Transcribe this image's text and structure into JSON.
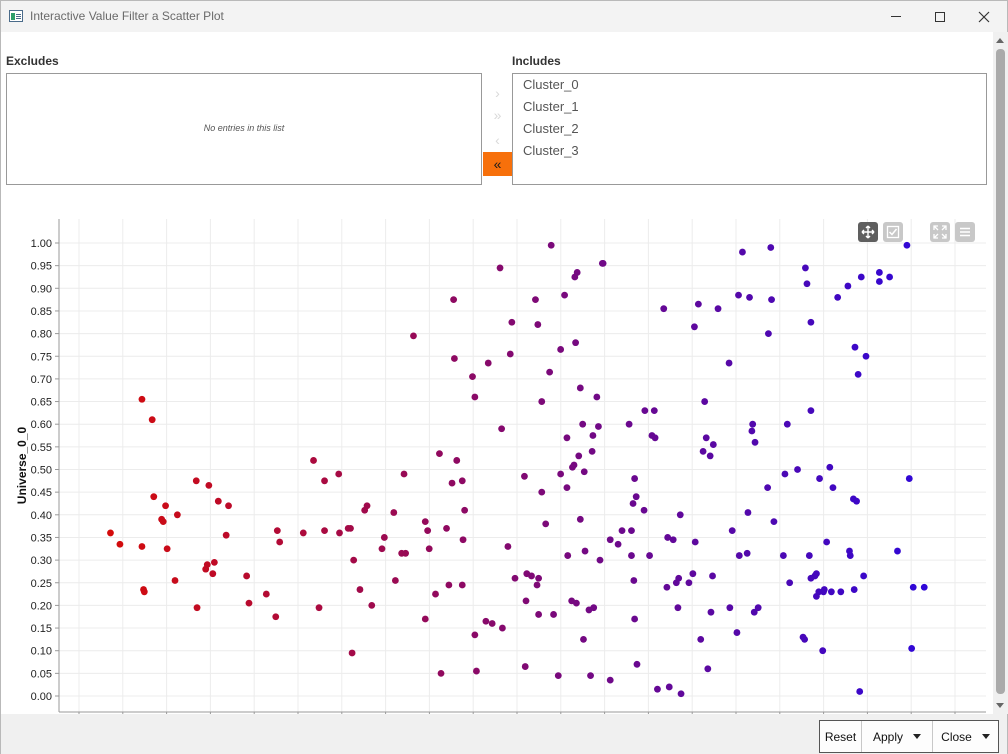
{
  "window": {
    "title": "Interactive Value Filter a Scatter Plot",
    "app_icon": "table-chart-icon",
    "controls": [
      "minimize-icon",
      "maximize-icon",
      "close-icon"
    ]
  },
  "filter": {
    "excludes_label": "Excludes",
    "includes_label": "Includes",
    "excludes_empty": "No entries in this list",
    "includes": [
      "Cluster_0",
      "Cluster_1",
      "Cluster_2",
      "Cluster_3"
    ],
    "arrows": [
      {
        "icon": "chevron-right-icon",
        "glyph": "›",
        "active": false
      },
      {
        "icon": "double-chevron-right-icon",
        "glyph": "»",
        "active": false
      },
      {
        "icon": "chevron-left-icon",
        "glyph": "‹",
        "active": false
      },
      {
        "icon": "double-chevron-left-icon",
        "glyph": "«",
        "active": true
      }
    ],
    "accent_color": "#f7700b"
  },
  "toolbar": {
    "icons": [
      "pan-icon",
      "selection-icon",
      "fullscreen-icon",
      "menu-icon"
    ]
  },
  "buttons": {
    "reset": "Reset",
    "apply": "Apply",
    "close": "Close"
  },
  "chart_data": {
    "type": "scatter",
    "ylabel": "Universe_0_0",
    "xlabel": "",
    "ylim": [
      0,
      1
    ],
    "xlim": [
      0,
      1
    ],
    "yticks": [
      "0.00",
      "0.05",
      "0.10",
      "0.15",
      "0.20",
      "0.25",
      "0.30",
      "0.35",
      "0.40",
      "0.45",
      "0.50",
      "0.55",
      "0.60",
      "0.65",
      "0.70",
      "0.75",
      "0.80",
      "0.85",
      "0.90",
      "0.95",
      "1.00"
    ],
    "grid": true,
    "color_gradient": [
      "#d40b0b",
      "#2f07d8"
    ],
    "points": [
      [
        0.04,
        0.36
      ],
      [
        0.052,
        0.335
      ],
      [
        0.08,
        0.655
      ],
      [
        0.08,
        0.33
      ],
      [
        0.082,
        0.235
      ],
      [
        0.083,
        0.23
      ],
      [
        0.093,
        0.61
      ],
      [
        0.095,
        0.44
      ],
      [
        0.105,
        0.39
      ],
      [
        0.107,
        0.385
      ],
      [
        0.11,
        0.42
      ],
      [
        0.112,
        0.325
      ],
      [
        0.122,
        0.255
      ],
      [
        0.125,
        0.4
      ],
      [
        0.149,
        0.475
      ],
      [
        0.15,
        0.195
      ],
      [
        0.161,
        0.28
      ],
      [
        0.163,
        0.29
      ],
      [
        0.165,
        0.465
      ],
      [
        0.172,
        0.295
      ],
      [
        0.17,
        0.27
      ],
      [
        0.177,
        0.43
      ],
      [
        0.187,
        0.355
      ],
      [
        0.19,
        0.42
      ],
      [
        0.213,
        0.265
      ],
      [
        0.216,
        0.205
      ],
      [
        0.238,
        0.225
      ],
      [
        0.25,
        0.175
      ],
      [
        0.252,
        0.365
      ],
      [
        0.255,
        0.34
      ],
      [
        0.285,
        0.36
      ],
      [
        0.298,
        0.52
      ],
      [
        0.305,
        0.195
      ],
      [
        0.312,
        0.475
      ],
      [
        0.312,
        0.365
      ],
      [
        0.33,
        0.49
      ],
      [
        0.331,
        0.36
      ],
      [
        0.342,
        0.37
      ],
      [
        0.345,
        0.37
      ],
      [
        0.347,
        0.095
      ],
      [
        0.349,
        0.3
      ],
      [
        0.357,
        0.235
      ],
      [
        0.363,
        0.41
      ],
      [
        0.366,
        0.42
      ],
      [
        0.372,
        0.2
      ],
      [
        0.388,
        0.35
      ],
      [
        0.385,
        0.325
      ],
      [
        0.4,
        0.405
      ],
      [
        0.402,
        0.255
      ],
      [
        0.41,
        0.315
      ],
      [
        0.415,
        0.315
      ],
      [
        0.413,
        0.49
      ],
      [
        0.425,
        0.795
      ],
      [
        0.44,
        0.385
      ],
      [
        0.44,
        0.17
      ],
      [
        0.445,
        0.325
      ],
      [
        0.443,
        0.365
      ],
      [
        0.453,
        0.225
      ],
      [
        0.46,
        0.05
      ],
      [
        0.458,
        0.535
      ],
      [
        0.467,
        0.37
      ],
      [
        0.47,
        0.245
      ],
      [
        0.476,
        0.875
      ],
      [
        0.474,
        0.47
      ],
      [
        0.48,
        0.52
      ],
      [
        0.477,
        0.745
      ],
      [
        0.487,
        0.475
      ],
      [
        0.487,
        0.245
      ],
      [
        0.49,
        0.41
      ],
      [
        0.488,
        0.345
      ],
      [
        0.5,
        0.705
      ],
      [
        0.503,
        0.66
      ],
      [
        0.505,
        0.055
      ],
      [
        0.503,
        0.135
      ],
      [
        0.517,
        0.165
      ],
      [
        0.52,
        0.735
      ],
      [
        0.525,
        0.16
      ],
      [
        0.535,
        0.945
      ],
      [
        0.537,
        0.59
      ],
      [
        0.538,
        0.15
      ],
      [
        0.545,
        0.33
      ],
      [
        0.548,
        0.755
      ],
      [
        0.55,
        0.825
      ],
      [
        0.554,
        0.26
      ],
      [
        0.566,
        0.485
      ],
      [
        0.567,
        0.065
      ],
      [
        0.568,
        0.21
      ],
      [
        0.569,
        0.27
      ],
      [
        0.575,
        0.265
      ],
      [
        0.58,
        0.875
      ],
      [
        0.584,
        0.26
      ],
      [
        0.582,
        0.245
      ],
      [
        0.583,
        0.82
      ],
      [
        0.584,
        0.18
      ],
      [
        0.588,
        0.65
      ],
      [
        0.588,
        0.45
      ],
      [
        0.593,
        0.38
      ],
      [
        0.598,
        0.715
      ],
      [
        0.6,
        0.995
      ],
      [
        0.603,
        0.18
      ],
      [
        0.609,
        0.045
      ],
      [
        0.612,
        0.49
      ],
      [
        0.612,
        0.765
      ],
      [
        0.617,
        0.885
      ],
      [
        0.62,
        0.46
      ],
      [
        0.62,
        0.57
      ],
      [
        0.621,
        0.31
      ],
      [
        0.626,
        0.21
      ],
      [
        0.627,
        0.505
      ],
      [
        0.629,
        0.51
      ],
      [
        0.63,
        0.925
      ],
      [
        0.632,
        0.205
      ],
      [
        0.633,
        0.935
      ],
      [
        0.631,
        0.78
      ],
      [
        0.637,
        0.68
      ],
      [
        0.635,
        0.53
      ],
      [
        0.637,
        0.39
      ],
      [
        0.64,
        0.6
      ],
      [
        0.641,
        0.125
      ],
      [
        0.642,
        0.495
      ],
      [
        0.643,
        0.32
      ],
      [
        0.648,
        0.19
      ],
      [
        0.65,
        0.045
      ],
      [
        0.652,
        0.54
      ],
      [
        0.653,
        0.575
      ],
      [
        0.654,
        0.195
      ],
      [
        0.658,
        0.66
      ],
      [
        0.66,
        0.595
      ],
      [
        0.662,
        0.3
      ],
      [
        0.665,
        0.955
      ],
      [
        0.666,
        0.955
      ],
      [
        0.675,
        0.035
      ],
      [
        0.675,
        0.345
      ],
      [
        0.685,
        0.335
      ],
      [
        0.69,
        0.365
      ],
      [
        0.699,
        0.6
      ],
      [
        0.702,
        0.365
      ],
      [
        0.702,
        0.31
      ],
      [
        0.704,
        0.425
      ],
      [
        0.706,
        0.48
      ],
      [
        0.705,
        0.255
      ],
      [
        0.706,
        0.17
      ],
      [
        0.708,
        0.44
      ],
      [
        0.709,
        0.07
      ],
      [
        0.718,
        0.41
      ],
      [
        0.719,
        0.63
      ],
      [
        0.725,
        0.31
      ],
      [
        0.731,
        0.63
      ],
      [
        0.728,
        0.575
      ],
      [
        0.732,
        0.57
      ],
      [
        0.735,
        0.015
      ],
      [
        0.743,
        0.855
      ],
      [
        0.747,
        0.24
      ],
      [
        0.748,
        0.35
      ],
      [
        0.75,
        0.02
      ],
      [
        0.755,
        0.345
      ],
      [
        0.759,
        0.25
      ],
      [
        0.761,
        0.195
      ],
      [
        0.762,
        0.26
      ],
      [
        0.764,
        0.4
      ],
      [
        0.765,
        0.005
      ],
      [
        0.775,
        0.25
      ],
      [
        0.78,
        0.27
      ],
      [
        0.782,
        0.815
      ],
      [
        0.783,
        0.34
      ],
      [
        0.787,
        0.865
      ],
      [
        0.79,
        0.125
      ],
      [
        0.793,
        0.54
      ],
      [
        0.795,
        0.65
      ],
      [
        0.797,
        0.57
      ],
      [
        0.799,
        0.06
      ],
      [
        0.802,
        0.53
      ],
      [
        0.803,
        0.185
      ],
      [
        0.805,
        0.265
      ],
      [
        0.806,
        0.555
      ],
      [
        0.812,
        0.855
      ],
      [
        0.826,
        0.735
      ],
      [
        0.827,
        0.195
      ],
      [
        0.83,
        0.365
      ],
      [
        0.836,
        0.14
      ],
      [
        0.838,
        0.885
      ],
      [
        0.839,
        0.31
      ],
      [
        0.843,
        0.98
      ],
      [
        0.849,
        0.315
      ],
      [
        0.85,
        0.405
      ],
      [
        0.852,
        0.88
      ],
      [
        0.855,
        0.585
      ],
      [
        0.856,
        0.6
      ],
      [
        0.858,
        0.185
      ],
      [
        0.859,
        0.56
      ],
      [
        0.863,
        0.195
      ],
      [
        0.875,
        0.46
      ],
      [
        0.876,
        0.8
      ],
      [
        0.879,
        0.99
      ],
      [
        0.88,
        0.875
      ],
      [
        0.883,
        0.385
      ],
      [
        0.895,
        0.31
      ],
      [
        0.897,
        0.49
      ],
      [
        0.9,
        0.6
      ],
      [
        0.903,
        0.25
      ],
      [
        0.913,
        0.5
      ],
      [
        0.92,
        0.13
      ],
      [
        0.922,
        0.125
      ],
      [
        0.923,
        0.945
      ],
      [
        0.925,
        0.91
      ],
      [
        0.928,
        0.31
      ],
      [
        0.93,
        0.825
      ],
      [
        0.93,
        0.63
      ],
      [
        0.93,
        0.26
      ],
      [
        0.935,
        0.265
      ],
      [
        0.937,
        0.22
      ],
      [
        0.937,
        0.27
      ],
      [
        0.94,
        0.23
      ],
      [
        0.941,
        0.48
      ],
      [
        0.945,
        0.1
      ],
      [
        0.946,
        0.23
      ],
      [
        0.947,
        0.235
      ],
      [
        0.95,
        0.34
      ],
      [
        0.954,
        0.505
      ],
      [
        0.956,
        0.23
      ],
      [
        0.958,
        0.46
      ],
      [
        0.964,
        0.88
      ],
      [
        0.968,
        0.23
      ],
      [
        0.977,
        0.905
      ],
      [
        0.979,
        0.32
      ],
      [
        0.98,
        0.31
      ],
      [
        0.984,
        0.435
      ],
      [
        0.985,
        0.235
      ],
      [
        0.986,
        0.77
      ],
      [
        0.988,
        0.43
      ],
      [
        0.99,
        0.71
      ],
      [
        0.992,
        0.01
      ],
      [
        0.994,
        0.925
      ],
      [
        0.997,
        0.265
      ],
      [
        1.0,
        0.75
      ],
      [
        1.017,
        0.915
      ],
      [
        1.017,
        0.935
      ],
      [
        1.03,
        0.925
      ],
      [
        1.04,
        0.32
      ],
      [
        1.052,
        0.995
      ],
      [
        1.055,
        0.48
      ],
      [
        1.058,
        0.105
      ],
      [
        1.06,
        0.24
      ],
      [
        1.074,
        0.24
      ]
    ]
  }
}
